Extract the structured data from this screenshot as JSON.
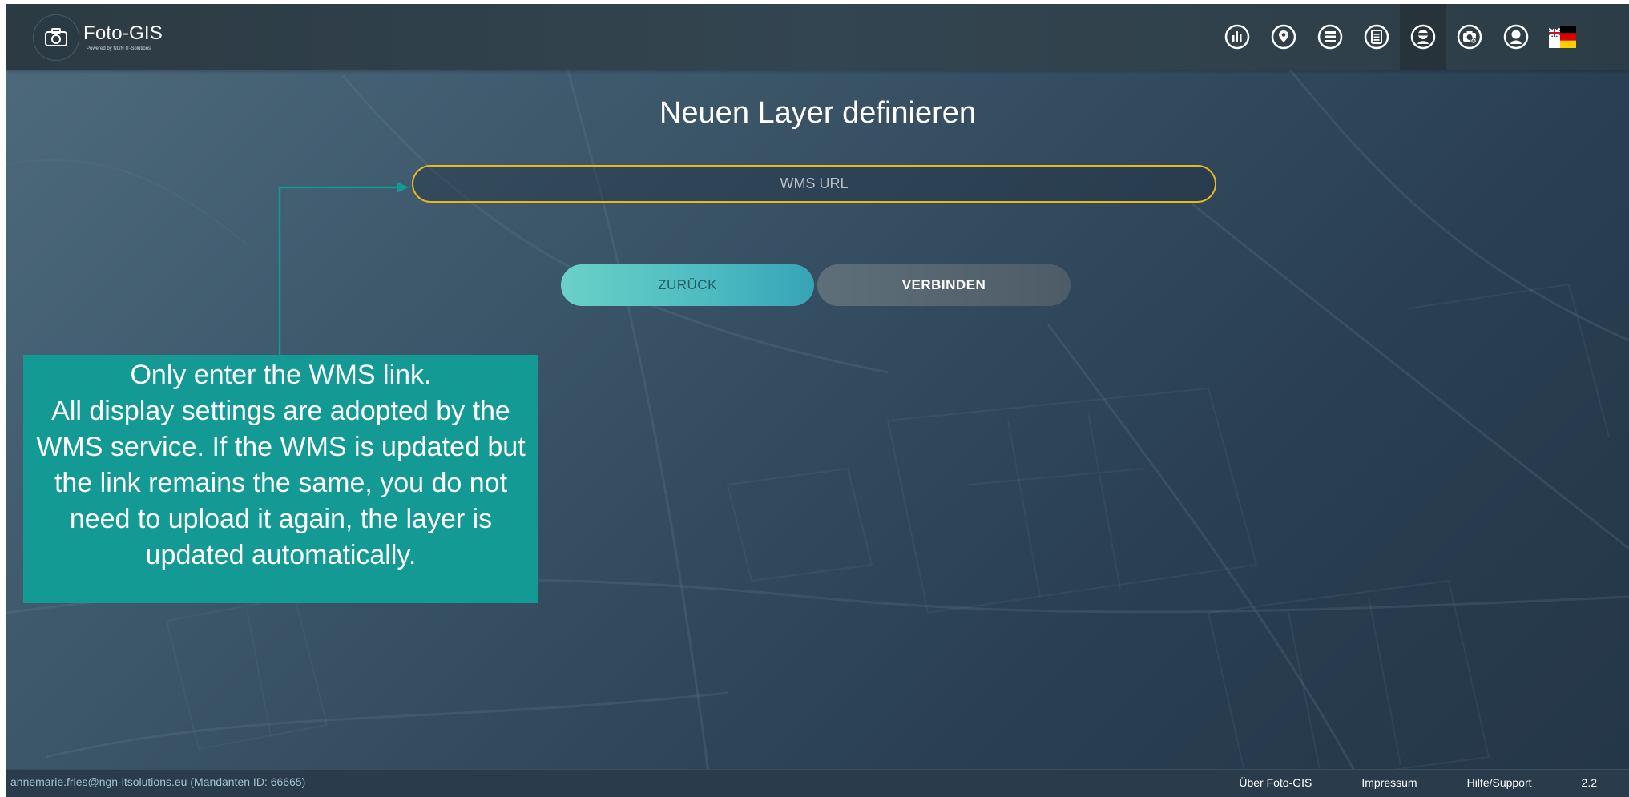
{
  "header": {
    "app_title": "Foto-GIS",
    "app_subtitle": "Powered by NGN IT-Solutions",
    "icons": [
      {
        "name": "statistics-icon"
      },
      {
        "name": "map-pin-icon"
      },
      {
        "name": "layers-list-icon"
      },
      {
        "name": "clipboard-icon"
      },
      {
        "name": "user-mask-icon",
        "active": true
      },
      {
        "name": "camera-add-icon"
      },
      {
        "name": "user-profile-icon"
      },
      {
        "name": "language-flag-icon"
      }
    ]
  },
  "main": {
    "title": "Neuen Layer definieren",
    "wms_url": {
      "value": "",
      "placeholder": "WMS URL"
    },
    "back_label": "ZURÜCK",
    "connect_label": "VERBINDEN"
  },
  "callout": {
    "lines": [
      "Only enter the WMS link.",
      "All display settings are adopted by the",
      "WMS service. If the WMS is updated but",
      "the link remains the same, you do not",
      "need to upload it again, the layer is",
      "updated automatically."
    ]
  },
  "footer": {
    "user": "annemarie.fries@ngn-itsolutions.eu (Mandanten ID: 66665)",
    "links": [
      "Über Foto-GIS",
      "Impressum",
      "Hilfe/Support"
    ],
    "version": "2.2"
  },
  "colors": {
    "accent_teal": "#139a95",
    "input_border": "#e8b820",
    "topbar": "#2f404a"
  }
}
